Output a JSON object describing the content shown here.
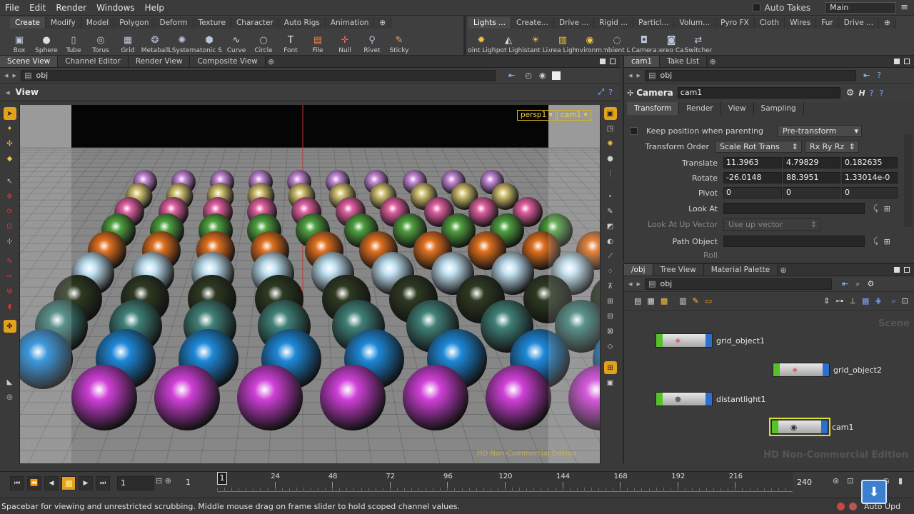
{
  "menu": [
    "File",
    "Edit",
    "Render",
    "Windows",
    "Help"
  ],
  "auto_takes": "Auto Takes",
  "main_desktop": "Main",
  "shelf_left": {
    "tabs": [
      "Create",
      "Modify",
      "Model",
      "Polygon",
      "Deform",
      "Texture",
      "Character",
      "Auto Rigs",
      "Animation"
    ],
    "tools": [
      {
        "label": "Box",
        "icon": "box-icon"
      },
      {
        "label": "Sphere",
        "icon": "sphere-icon"
      },
      {
        "label": "Tube",
        "icon": "tube-icon"
      },
      {
        "label": "Torus",
        "icon": "torus-icon"
      },
      {
        "label": "Grid",
        "icon": "grid-icon"
      },
      {
        "label": "Metaball",
        "icon": "metaball-icon"
      },
      {
        "label": "LSystem",
        "icon": "lsystem-icon"
      },
      {
        "label": "Platonic S...",
        "icon": "platonic-icon"
      },
      {
        "label": "Curve",
        "icon": "curve-icon"
      },
      {
        "label": "Circle",
        "icon": "circle-icon"
      },
      {
        "label": "Font",
        "icon": "font-icon"
      },
      {
        "label": "File",
        "icon": "file-icon"
      },
      {
        "label": "Null",
        "icon": "null-icon"
      },
      {
        "label": "Rivet",
        "icon": "rivet-icon"
      },
      {
        "label": "Sticky",
        "icon": "sticky-icon"
      }
    ]
  },
  "shelf_right": {
    "tabs": [
      "Lights ...",
      "Create...",
      "Drive ...",
      "Rigid ...",
      "Particl...",
      "Volum...",
      "Pyro FX",
      "Cloth",
      "Wires",
      "Fur",
      "Drive ..."
    ],
    "tools": [
      {
        "label": "Point Light",
        "icon": "point-light-icon"
      },
      {
        "label": "Spot Light",
        "icon": "spot-light-icon"
      },
      {
        "label": "Distant Li...",
        "icon": "distant-light-icon"
      },
      {
        "label": "Area Light",
        "icon": "area-light-icon"
      },
      {
        "label": "Environm...",
        "icon": "environment-light-icon"
      },
      {
        "label": "Ambient L...",
        "icon": "ambient-light-icon"
      },
      {
        "label": "Camera",
        "icon": "camera-icon"
      },
      {
        "label": "Stereo Ca...",
        "icon": "stereo-camera-icon"
      },
      {
        "label": "Switcher",
        "icon": "switcher-icon"
      }
    ]
  },
  "left_pane": {
    "tabs": [
      "Scene View",
      "Channel Editor",
      "Render View",
      "Composite View"
    ],
    "path": "obj",
    "title": "View",
    "persp": "persp1",
    "cam": "cam1",
    "watermark": "HD Non-Commercial Edition"
  },
  "param_pane": {
    "tabs": [
      "cam1",
      "Take List"
    ],
    "path": "obj",
    "node_type": "Camera",
    "node_name": "cam1",
    "subtabs": [
      "Transform",
      "Render",
      "View",
      "Sampling"
    ],
    "keep_pos": "Keep position when parenting",
    "pre_transform": "Pre-transform",
    "transform_order_label": "Transform Order",
    "transform_order": "Scale Rot Trans",
    "rot_order": "Rx Ry Rz",
    "translate_label": "Translate",
    "translate": [
      "11.3963",
      "4.79829",
      "0.182635"
    ],
    "rotate_label": "Rotate",
    "rotate": [
      "-26.0148",
      "88.3951",
      "1.33014e-0"
    ],
    "pivot_label": "Pivot",
    "pivot": [
      "0",
      "0",
      "0"
    ],
    "lookat_label": "Look At",
    "lookup_label": "Look At Up Vector",
    "lookup_value": "Use up vector",
    "pathobj_label": "Path Object",
    "roll_label": "Roll"
  },
  "network_pane": {
    "tabs": [
      "/obj",
      "Tree View",
      "Material Palette"
    ],
    "path": "obj",
    "watermark": "HD Non-Commercial Edition",
    "corner_text": "Scene",
    "nodes": [
      {
        "label": "grid_object1",
        "icon": "geometry-node-icon"
      },
      {
        "label": "grid_object2",
        "icon": "geometry-node-icon"
      },
      {
        "label": "distantlight1",
        "icon": "light-node-icon"
      },
      {
        "label": "cam1",
        "icon": "camera-node-icon"
      }
    ]
  },
  "timeline": {
    "frame": "1",
    "start": "1",
    "marker": "1",
    "ticks": [
      "24",
      "48",
      "72",
      "96",
      "120",
      "144",
      "168",
      "192",
      "216"
    ],
    "end": "240",
    "auto_update": "Auto Upd"
  },
  "status_text": "Spacebar for viewing and unrestricted scrubbing. Middle mouse drag on frame slider to hold scoped channel values.",
  "colors": {
    "accent": "#f0a020",
    "selected_node": "#d8e030",
    "node_green": "#56c22a",
    "node_blue": "#2b6fd0"
  }
}
